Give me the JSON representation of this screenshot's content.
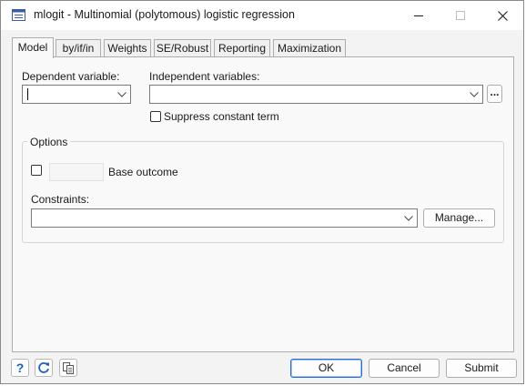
{
  "window": {
    "title": "mlogit - Multinomial (polytomous) logistic regression"
  },
  "tabs": [
    {
      "label": "Model"
    },
    {
      "label": "by/if/in"
    },
    {
      "label": "Weights"
    },
    {
      "label": "SE/Robust"
    },
    {
      "label": "Reporting"
    },
    {
      "label": "Maximization"
    }
  ],
  "model": {
    "dependent_label": "Dependent variable:",
    "dependent_value": "",
    "independent_label": "Independent variables:",
    "independent_value": "",
    "browse_label": "...",
    "suppress_constant_label": "Suppress constant term",
    "suppress_constant_checked": false
  },
  "options": {
    "title": "Options",
    "base_outcome_label": "Base outcome",
    "base_outcome_checked": false,
    "base_outcome_value": "",
    "constraints_label": "Constraints:",
    "constraints_value": "",
    "manage_label": "Manage..."
  },
  "footer": {
    "help_icon": "help-icon",
    "reset_icon": "reset-icon",
    "copy_icon": "copy-command-icon",
    "ok_label": "OK",
    "cancel_label": "Cancel",
    "submit_label": "Submit"
  },
  "colors": {
    "accent": "#2b6bd6",
    "help_blue": "#1f5fbf"
  }
}
